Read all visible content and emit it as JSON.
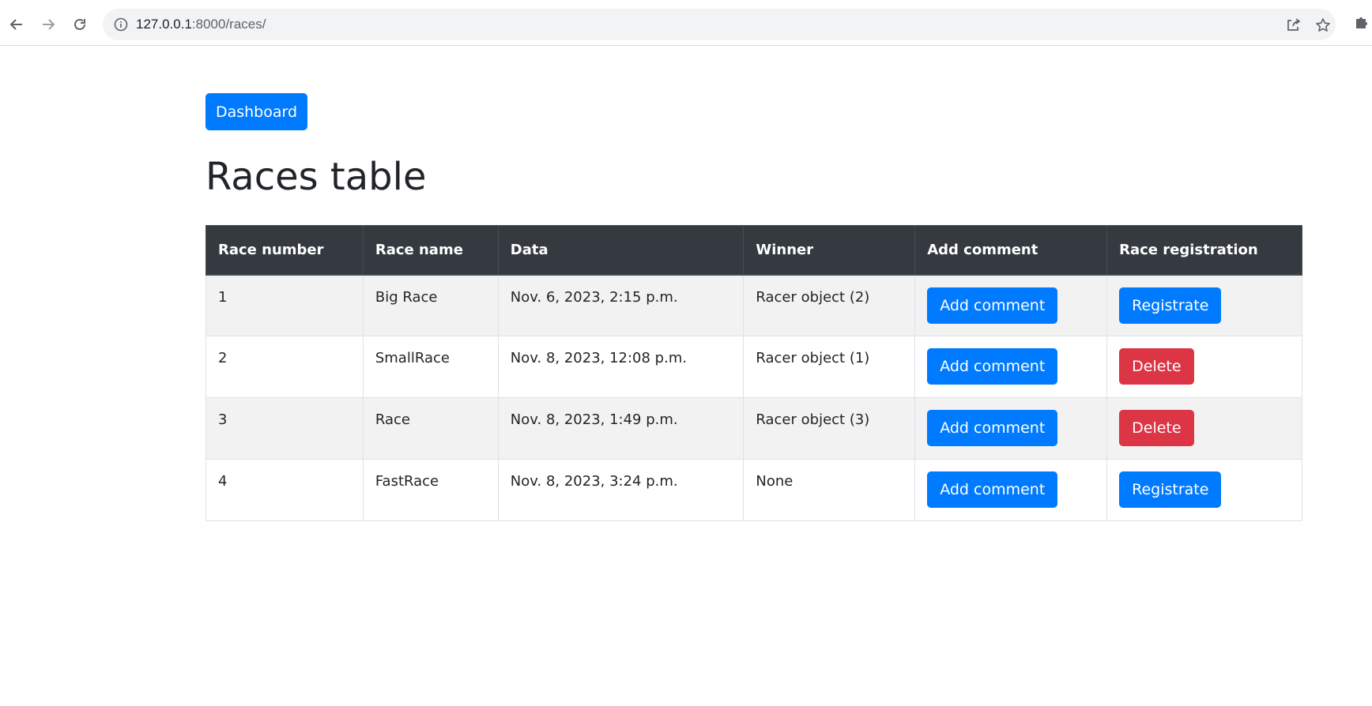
{
  "browser": {
    "url_host": "127.0.0.1",
    "url_rest": ":8000/races/"
  },
  "page": {
    "dashboard_label": "Dashboard",
    "title": "Races table"
  },
  "table": {
    "headers": [
      "Race number",
      "Race name",
      "Data",
      "Winner",
      "Add comment",
      "Race registration"
    ],
    "rows": [
      {
        "number": "1",
        "name": "Big Race",
        "date": "Nov. 6, 2023, 2:15 p.m.",
        "winner": "Racer object (2)",
        "comment_label": "Add comment",
        "action_label": "Registrate",
        "action_type": "primary"
      },
      {
        "number": "2",
        "name": "SmallRace",
        "date": "Nov. 8, 2023, 12:08 p.m.",
        "winner": "Racer object (1)",
        "comment_label": "Add comment",
        "action_label": "Delete",
        "action_type": "danger"
      },
      {
        "number": "3",
        "name": "Race",
        "date": "Nov. 8, 2023, 1:49 p.m.",
        "winner": "Racer object (3)",
        "comment_label": "Add comment",
        "action_label": "Delete",
        "action_type": "danger"
      },
      {
        "number": "4",
        "name": "FastRace",
        "date": "Nov. 8, 2023, 3:24 p.m.",
        "winner": "None",
        "comment_label": "Add comment",
        "action_label": "Registrate",
        "action_type": "primary"
      }
    ]
  },
  "colors": {
    "primary": "#007bff",
    "danger": "#dc3545",
    "table_header": "#343a40"
  },
  "icons": [
    "back-arrow-icon",
    "forward-arrow-icon",
    "reload-icon",
    "info-icon",
    "share-icon",
    "star-icon",
    "extension-puzzle-icon"
  ]
}
